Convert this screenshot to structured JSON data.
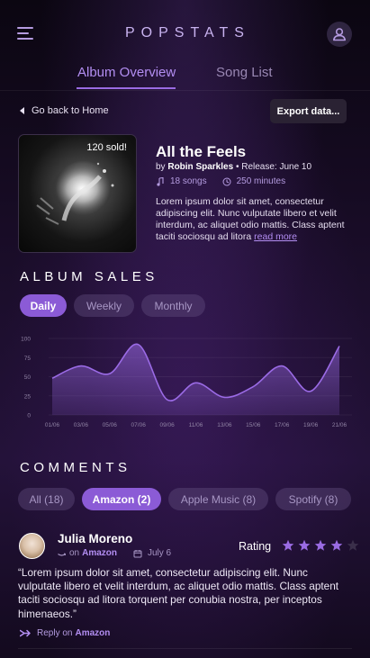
{
  "header": {
    "title": "POPSTATS"
  },
  "tabs": [
    {
      "label": "Album Overview",
      "active": true
    },
    {
      "label": "Song List",
      "active": false
    }
  ],
  "nav": {
    "back_label": "Go back to Home",
    "export_label": "Export data..."
  },
  "album": {
    "sold_badge": "120 sold!",
    "title": "All the Feels",
    "by_prefix": "by",
    "artist": "Robin Sparkles",
    "release_prefix": "• Release:",
    "release_date": "June 10",
    "songs": "18 songs",
    "duration": "250 minutes",
    "description": "Lorem ipsum dolor sit amet, consectetur adipiscing elit. Nunc vulputate libero et velit interdum, ac aliquet odio mattis. Class aptent taciti sociosqu ad litora",
    "read_more": "read more"
  },
  "sales": {
    "title": "ALBUM SALES",
    "filters": [
      {
        "label": "Daily",
        "active": true
      },
      {
        "label": "Weekly",
        "active": false
      },
      {
        "label": "Monthly",
        "active": false
      }
    ]
  },
  "chart_data": {
    "type": "area",
    "title": "",
    "xlabel": "",
    "ylabel": "",
    "x_ticks": [
      "01/06",
      "03/06",
      "05/06",
      "07/06",
      "09/06",
      "11/06",
      "13/06",
      "15/06",
      "17/06",
      "19/06",
      "21/06"
    ],
    "y_ticks": [
      0,
      25,
      50,
      75,
      100
    ],
    "ylim": [
      0,
      100
    ],
    "x": [
      0,
      1,
      2,
      3,
      4,
      5,
      6,
      7,
      8,
      9,
      10
    ],
    "series": [
      {
        "values": [
          48,
          64,
          54,
          92,
          20,
          42,
          23,
          37,
          64,
          31,
          90
        ]
      }
    ],
    "grid": true,
    "color": "#9b6be6"
  },
  "comments": {
    "title": "COMMENTS",
    "filters": [
      {
        "label": "All (18)",
        "active": false
      },
      {
        "label": "Amazon (2)",
        "active": true
      },
      {
        "label": "Apple Music (8)",
        "active": false
      },
      {
        "label": "Spotify (8)",
        "active": false
      }
    ],
    "items": [
      {
        "name": "Julia Moreno",
        "source_prefix": "on",
        "source": "Amazon",
        "date": "July 6",
        "rating_label": "Rating",
        "rating": 4,
        "rating_max": 5,
        "text": "“Lorem ipsum dolor sit amet, consectetur adipiscing elit. Nunc vulputate libero et velit interdum, ac aliquet odio mattis. Class aptent taciti sociosqu ad litora torquent per conubia nostra, per inceptos himenaeos.”",
        "reply_prefix": "Reply on",
        "reply_target": "Amazon"
      }
    ]
  },
  "colors": {
    "accent": "#8b5bd6",
    "accent_text": "#b38ef2",
    "background": "#0d0714"
  },
  "icons": {
    "menu": "hamburger-menu-icon",
    "user": "user-profile-icon",
    "back": "triangle-left-icon",
    "music": "music-note-icon",
    "clock": "clock-icon",
    "calendar": "calendar-icon",
    "amazon": "amazon-logo-icon",
    "star": "star-icon",
    "reply": "reply-arrow-icon"
  }
}
